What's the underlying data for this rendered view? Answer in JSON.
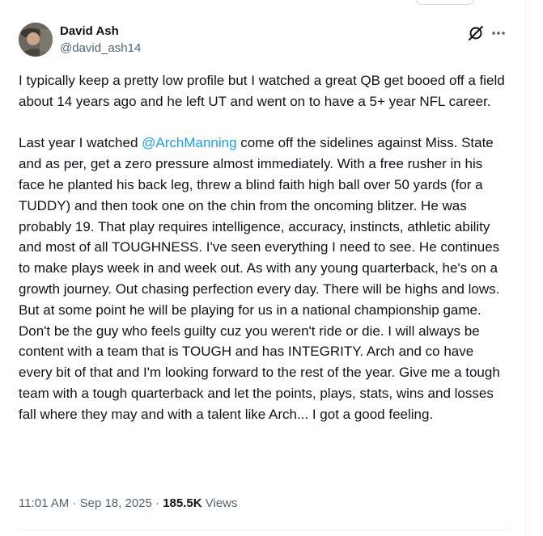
{
  "author": {
    "display_name": "David Ash",
    "handle": "@david_ash14"
  },
  "actions": {
    "grok_icon": "grok-icon",
    "more_icon": "more-icon"
  },
  "tweet": {
    "para1": "I typically keep a pretty low profile but I watched a great QB get booed off a field about 14 years ago and he left UT and went on to have a 5+ year NFL career.",
    "para2_before": "Last year I watched ",
    "mention": "@ArchManning",
    "para2_after": " come off the sidelines against Miss. State and as per, get a zero pressure almost immediately. With a free rusher in his face he planted his back leg, threw a blind faith high ball over 50 yards (for a TUDDY) and then took one on the chin from the oncoming blitzer. He was probably 19. That play requires intelligence, accuracy, instincts, athletic ability and most of all TOUGHNESS. I've seen everything I need to see. He continues to make plays week in and week out. As with any young quarterback, he's on a growth journey. Out chasing perfection every day. There will be highs and lows. But at some point he will be playing for us in a national championship game. Don't be the guy who feels guilty cuz you weren't ride or die. I will always be content with a team that is TOUGH and has INTEGRITY. Arch and co have every bit of that and I'm looking forward to the rest of the year. Give me a tough team with a tough quarterback and let the points, plays, stats, wins and losses fall where they may and with a talent like Arch... I got a good feeling."
  },
  "meta": {
    "time": "11:01 AM",
    "separator": "·",
    "date": "Sep 18, 2025",
    "views_count": "185.5K",
    "views_label": "Views"
  },
  "colors": {
    "text": "#0f1419",
    "secondary": "#536471",
    "link": "#1d9bf0",
    "divider": "#eff3f4"
  }
}
